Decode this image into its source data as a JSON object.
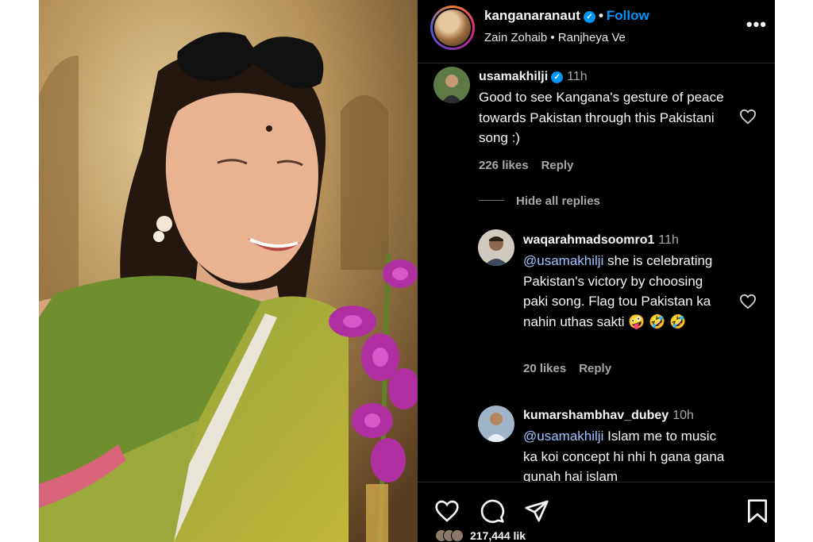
{
  "post": {
    "username": "kanganaranaut",
    "verified_badge": "verified-icon",
    "separator": "•",
    "follow_label": "Follow",
    "song": "Zain Zohaib • Ranjheya Ve",
    "more_label": "•••"
  },
  "comments": [
    {
      "username": "usamakhilji",
      "verified": true,
      "time": "11h",
      "text": "Good to see Kangana's gesture of peace towards Pakistan through this Pakistani song :)",
      "likes": "226 likes",
      "reply_label": "Reply"
    }
  ],
  "hide_replies_label": "Hide all replies",
  "replies": [
    {
      "username": "waqarahmadsoomro1",
      "time": "11h",
      "mention": "@usamakhilji",
      "text": "she is celebrating Pakistan's victory by choosing paki song. Flag tou Pakistan ka nahin uthas sakti 🤪 🤣 🤣",
      "likes": "20 likes",
      "reply_label": "Reply"
    },
    {
      "username": "kumarshambhav_dubey",
      "time": "10h",
      "mention": "@usamakhilji",
      "text": "Islam me to music ka koi concept hi nhi h gana gana gunah hai islam"
    }
  ],
  "actions": {
    "icons": [
      "heart-icon",
      "comment-icon",
      "share-icon",
      "bookmark-icon"
    ],
    "likes_count_partial": "217,444 lik"
  },
  "colors": {
    "panel_bg": "#000000",
    "accent": "#0095f6",
    "muted": "#a8a8a8",
    "mention": "#9fc4ff"
  }
}
